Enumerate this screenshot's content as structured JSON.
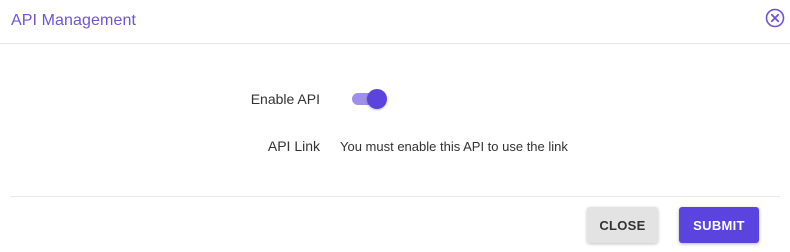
{
  "dialog": {
    "title": "API Management",
    "close_icon": "close-circle-icon"
  },
  "form": {
    "enable_api": {
      "label": "Enable API",
      "enabled": true
    },
    "api_link": {
      "label": "API Link",
      "value": "You must enable this API to use the link"
    }
  },
  "footer": {
    "close_label": "CLOSE",
    "submit_label": "SUBMIT"
  },
  "colors": {
    "accent": "#5b43de",
    "title": "#6b55d9",
    "toggle_track": "#9f8fe8",
    "secondary_button": "#e3e3e3"
  }
}
